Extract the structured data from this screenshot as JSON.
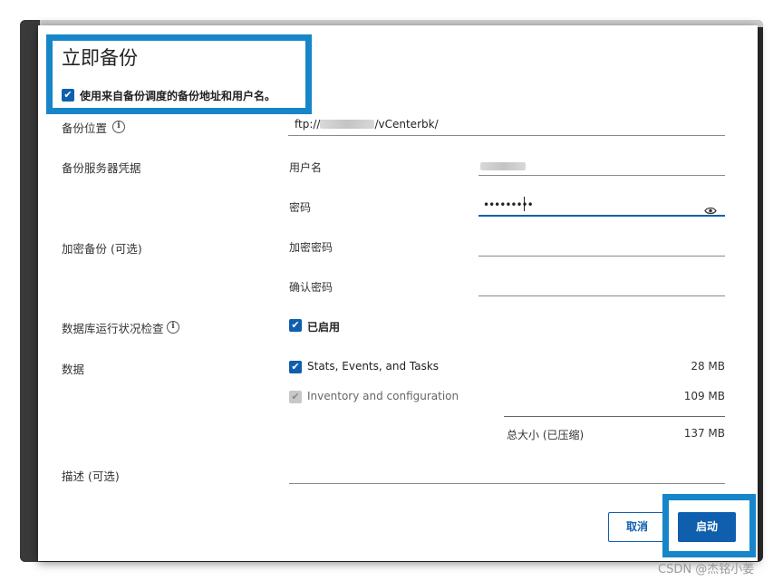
{
  "dialog": {
    "title": "立即备份",
    "use_saved_label": "使用来自备份调度的备份地址和用户名。",
    "use_saved_checked": true
  },
  "backup_location": {
    "label": "备份位置",
    "value_prefix": "ftp://",
    "value_suffix": "/vCenterbk/"
  },
  "server_credentials": {
    "label": "备份服务器凭据",
    "username_label": "用户名",
    "password_label": "密码",
    "password_value": "•••••••••"
  },
  "encryption": {
    "label": "加密备份 (可选)",
    "encrypt_password_label": "加密密码",
    "confirm_password_label": "确认密码"
  },
  "db_health": {
    "label": "数据库运行状况检查",
    "enabled_label": "已启用",
    "checked": true
  },
  "data": {
    "label": "数据",
    "items": [
      {
        "label": "Stats, Events, and Tasks",
        "size": "28 MB",
        "checked": true,
        "disabled": false
      },
      {
        "label": "Inventory and configuration",
        "size": "109 MB",
        "checked": true,
        "disabled": true
      }
    ],
    "total_label": "总大小 (已压缩)",
    "total_size": "137 MB"
  },
  "description": {
    "label": "描述 (可选)"
  },
  "footer": {
    "cancel_label": "取消",
    "start_label": "启动"
  },
  "icons": {
    "check": "✔",
    "info": "i",
    "eye": "eye-icon"
  },
  "watermark": "CSDN @杰铭小姜",
  "colors": {
    "accent": "#0f5fae",
    "highlight": "#1686c9"
  }
}
